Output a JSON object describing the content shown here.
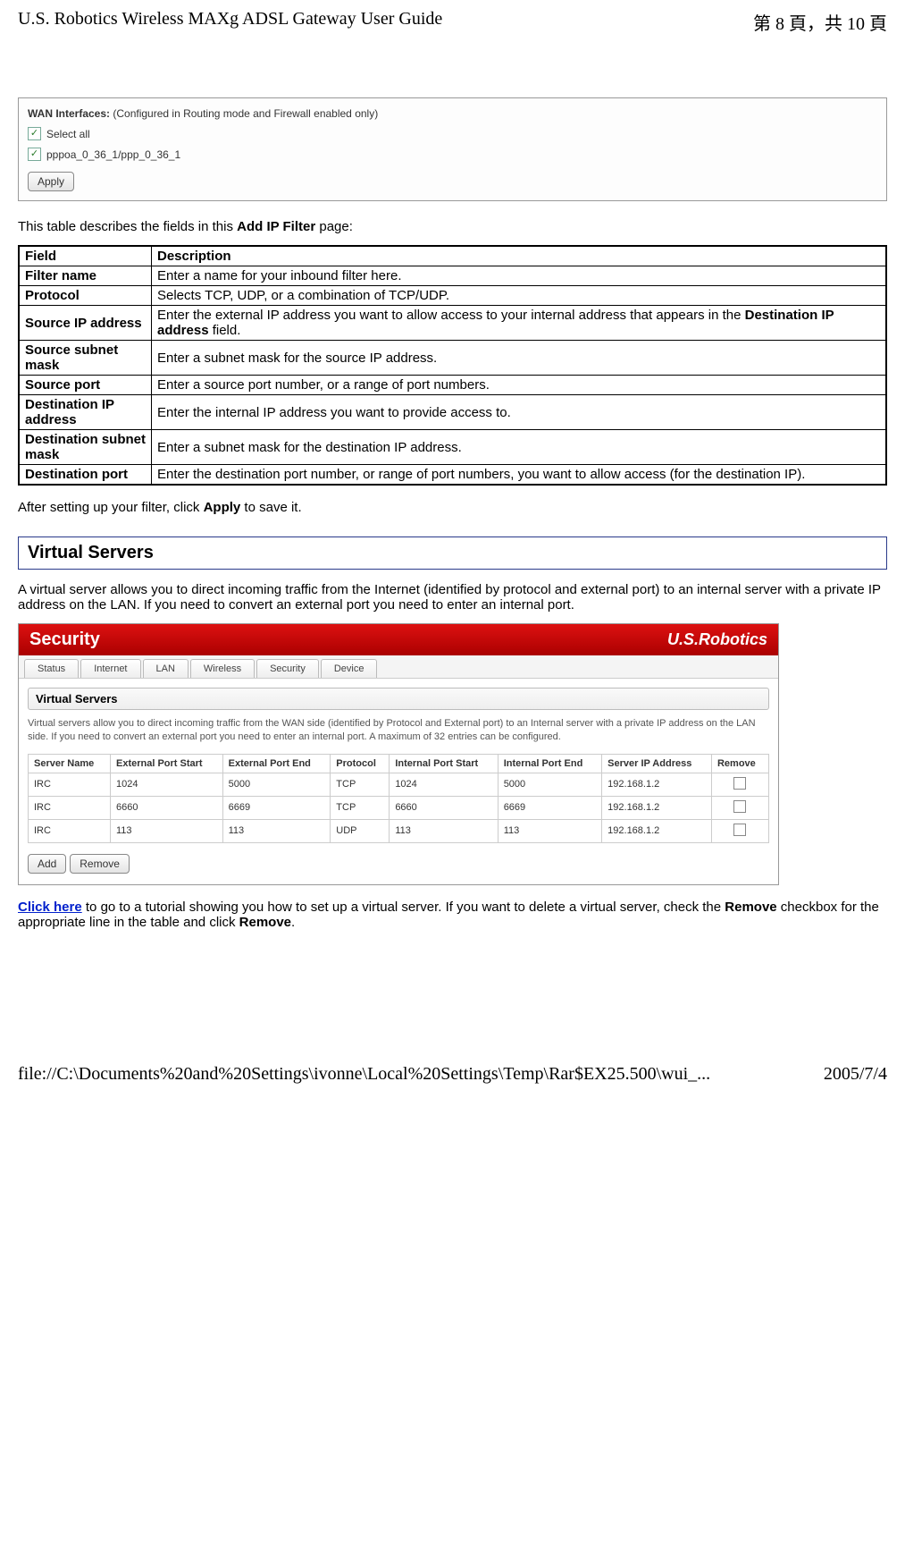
{
  "header": {
    "title": "U.S. Robotics Wireless MAXg ADSL Gateway User Guide",
    "page_indicator": "第 8 頁，共 10 頁"
  },
  "wan_panel": {
    "label_prefix": "WAN Interfaces:",
    "label_suffix": " (Configured in Routing mode and Firewall enabled only)",
    "select_all": "Select all",
    "interface": "pppoa_0_36_1/ppp_0_36_1",
    "apply": "Apply"
  },
  "intro_text_pre": "This table describes the fields in this ",
  "intro_text_bold": "Add IP Filter",
  "intro_text_post": " page:",
  "table_header_field": "Field",
  "table_header_desc": "Description",
  "fields": [
    {
      "f": "Filter name",
      "d": "Enter a name for your inbound filter here."
    },
    {
      "f": "Protocol",
      "d": "Selects TCP, UDP, or a combination of TCP/UDP."
    },
    {
      "f": "Source IP address",
      "d_pre": "Enter the external IP address you want to allow access to your internal address that appears in the ",
      "d_bold": "Destination IP address",
      "d_post": " field."
    },
    {
      "f": "Source subnet mask",
      "d": "Enter a subnet mask for the source IP address."
    },
    {
      "f": "Source port",
      "d": "Enter a source port number, or a range of port numbers."
    },
    {
      "f": "Destination IP address",
      "d": "Enter the internal IP address you want to provide access to."
    },
    {
      "f": "Destination subnet mask",
      "d": "Enter a subnet mask for the destination IP address."
    },
    {
      "f": "Destination port",
      "d": "Enter the destination port number, or range of port numbers, you want to allow access (for the destination IP)."
    }
  ],
  "after_text_pre": "After setting up your filter, click ",
  "after_text_bold": "Apply",
  "after_text_post": " to save it.",
  "section_title": "Virtual Servers",
  "vs_para": "A virtual server allows you to direct incoming traffic from the Internet (identified by protocol and external port) to an internal server with a private IP address on the LAN. If you need to convert an external port you need to enter an internal port.",
  "vs_shot": {
    "banner_left": "Security",
    "banner_right": "U.S.Robotics",
    "tabs": [
      "Status",
      "Internet",
      "LAN",
      "Wireless",
      "Security",
      "Device"
    ],
    "panel_title": "Virtual Servers",
    "panel_desc": "Virtual servers allow you to direct incoming traffic from the WAN side (identified by Protocol and External port) to an Internal server with a private IP address on the LAN side. If you need to convert an external port you need to enter an internal port. A maximum of 32 entries can be configured.",
    "cols": [
      "Server Name",
      "External Port Start",
      "External Port End",
      "Protocol",
      "Internal Port Start",
      "Internal Port End",
      "Server IP Address",
      "Remove"
    ],
    "rows": [
      [
        "IRC",
        "1024",
        "5000",
        "TCP",
        "1024",
        "5000",
        "192.168.1.2"
      ],
      [
        "IRC",
        "6660",
        "6669",
        "TCP",
        "6660",
        "6669",
        "192.168.1.2"
      ],
      [
        "IRC",
        "113",
        "113",
        "UDP",
        "113",
        "113",
        "192.168.1.2"
      ]
    ],
    "btn_add": "Add",
    "btn_remove": "Remove"
  },
  "click_here": "Click here",
  "click_text_1": " to go to a tutorial showing you how to set up a virtual server. If you want to delete a virtual server, check the ",
  "click_bold_1": "Remove",
  "click_text_2": " checkbox for the appropriate line in the table and click ",
  "click_bold_2": "Remove",
  "click_text_3": ".",
  "footer": {
    "path": "file://C:\\Documents%20and%20Settings\\ivonne\\Local%20Settings\\Temp\\Rar$EX25.500\\wui_...",
    "date": "2005/7/4"
  }
}
